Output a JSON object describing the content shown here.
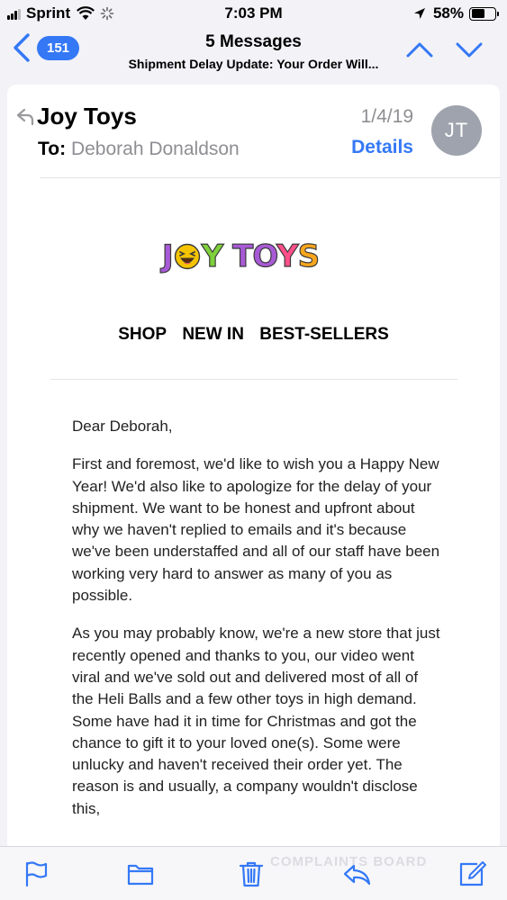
{
  "status_bar": {
    "carrier": "Sprint",
    "time": "7:03 PM",
    "battery_percent": "58%",
    "battery_level": 0.58,
    "icons": [
      "signal-icon",
      "wifi-icon",
      "activity-spinner-icon",
      "location-arrow-icon",
      "battery-icon"
    ]
  },
  "nav": {
    "back_count": "151",
    "title": "5 Messages",
    "subtitle": "Shipment Delay Update: Your Order Will...",
    "icons": [
      "back-chevron-icon",
      "chevron-up-icon",
      "chevron-down-icon"
    ]
  },
  "message": {
    "sender": "Joy Toys",
    "to_label": "To:",
    "to_name": "Deborah Donaldson",
    "date": "1/4/19",
    "details_label": "Details",
    "avatar_initials": "JT"
  },
  "email": {
    "logo_text_before": "J",
    "logo_text_after": "Y TOYS",
    "nav_links": [
      "SHOP",
      "NEW IN",
      "BEST-SELLERS"
    ],
    "greeting": "Dear Deborah,",
    "paragraphs": [
      "First and foremost, we'd like to wish you a Happy New Year! We'd also like to apologize for the delay of your shipment. We want to be honest and upfront about why we haven't replied to emails and it's because we've been understaffed and all of our staff have been working very hard to answer as many of you as possible.",
      "As you may probably know, we're a new store that just recently opened and thanks to you, our video went viral and we've sold out and delivered most of all of the Heli Balls and a few other toys in high demand. Some have had it in time for Christmas and got the chance to gift it to your loved one(s). Some were unlucky and haven't received their order yet. The reason is and usually, a company wouldn't disclose this,"
    ]
  },
  "toolbar": {
    "items": [
      "flag-icon",
      "folder-icon",
      "trash-icon",
      "reply-icon",
      "compose-icon"
    ],
    "watermark": "COMPLAINTS BOARD"
  },
  "colors": {
    "accent": "#3478f6",
    "secondary_text": "#8e8e93",
    "avatar_bg": "#9ea3ad",
    "logo_purple": "#a85ad6",
    "logo_green": "#7fd13b",
    "logo_orange": "#f7a51c",
    "logo_pink": "#ff4f8b",
    "logo_emoji": "#f5c400"
  }
}
